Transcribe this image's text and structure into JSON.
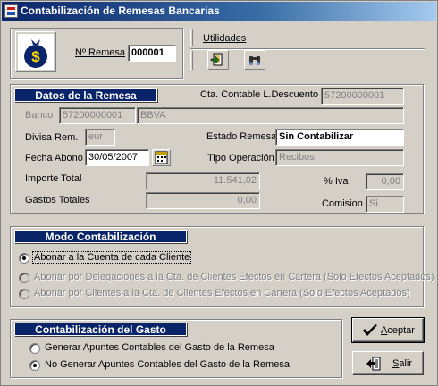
{
  "window": {
    "title": "Contabilización de Remesas Bancarias",
    "icon": "app-window-icon"
  },
  "header": {
    "logo_icon": "money-bag-icon",
    "remesa_label": "Nº Remesa",
    "remesa_value": "000001",
    "utilidades_label": "Utilidades",
    "tool_icons": [
      "export-report-icon",
      "binoculars-search-icon"
    ]
  },
  "datos": {
    "title": "Datos de la Remesa",
    "cta_contable_label": "Cta. Contable L.Descuento",
    "cta_contable_value": "57200000001",
    "banco_label": "Banco",
    "banco_code": "57200000001",
    "banco_name": "BBVA",
    "divisa_label": "Divisa Rem.",
    "divisa_value": "eur",
    "estado_label": "Estado Remesa",
    "estado_value": "Sin Contabilizar",
    "fecha_label": "Fecha Abono",
    "fecha_value": "30/05/2007",
    "calendar_icon": "calendar-icon",
    "tipo_label": "Tipo Operación",
    "tipo_value": "Recibos",
    "importe_label": "Importe Total",
    "importe_value": "11.541,02",
    "iva_label": "% Iva",
    "iva_value": "0,00",
    "gastos_label": "Gastos Totales",
    "gastos_value": "0,00",
    "comision_label": "Comision",
    "comision_value": "Si"
  },
  "modo": {
    "title": "Modo Contabilización",
    "options": [
      {
        "label": "Abonar a la Cuenta de cada Cliente",
        "checked": true,
        "enabled": true
      },
      {
        "label": "Abonar por Delegaciones a la Cta. de Clientes Efectos en Cartera (Solo Efectos Aceptados)",
        "checked": false,
        "enabled": false
      },
      {
        "label": "Abonar por Clientes a la Cta. de Clientes Efectos en Cartera (Solo Efectos Aceptados)",
        "checked": false,
        "enabled": false
      }
    ]
  },
  "gasto": {
    "title": "Contabilización del Gasto",
    "options": [
      {
        "label": "Generar Apuntes Contables del Gasto de la Remesa",
        "checked": false
      },
      {
        "label": "No Generar Apuntes Contables del Gasto de la Remesa",
        "checked": true
      }
    ]
  },
  "buttons": {
    "aceptar_label": "Aceptar",
    "aceptar_icon": "checkmark-icon",
    "salir_label": "Salir",
    "salir_icon": "exit-door-icon"
  }
}
